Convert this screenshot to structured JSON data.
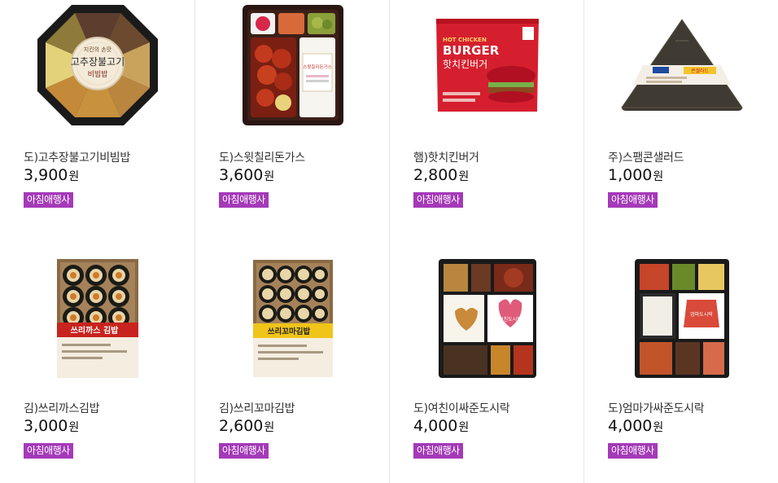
{
  "products": [
    {
      "name": "도)고추장불고기비빔밥",
      "price": "3,900",
      "unit": "원",
      "badge": "아침애행사",
      "label": "고추장불고기",
      "sublabel": "비빔밥"
    },
    {
      "name": "도)스윗칠리돈가스",
      "price": "3,600",
      "unit": "원",
      "badge": "아침애행사",
      "label": "스윗칠리돈가스"
    },
    {
      "name": "햄)핫치킨버거",
      "price": "2,800",
      "unit": "원",
      "badge": "아침애행사",
      "label_top": "HOT CHICKEN",
      "label_mid": "BURGER",
      "label_kr": "핫치킨버거"
    },
    {
      "name": "주)스팸콘샐러드",
      "price": "1,000",
      "unit": "원",
      "badge": "아침애행사",
      "label": "콘샐러드"
    },
    {
      "name": "김)쓰리까스김밥",
      "price": "3,000",
      "unit": "원",
      "badge": "아침애행사",
      "label": "쓰리까스 김밥"
    },
    {
      "name": "김)쓰리꼬마김밥",
      "price": "2,600",
      "unit": "원",
      "badge": "아침애행사",
      "label": "쓰리꼬마김밥"
    },
    {
      "name": "도)여친이싸준도시락",
      "price": "4,000",
      "unit": "원",
      "badge": "아침애행사",
      "label": "여친도시락"
    },
    {
      "name": "도)엄마가싸준도시락",
      "price": "4,000",
      "unit": "원",
      "badge": "아침애행사",
      "label": "엄마도시락"
    }
  ],
  "colors": {
    "badge": "#a43ab8",
    "divider": "#e6e6e6"
  }
}
